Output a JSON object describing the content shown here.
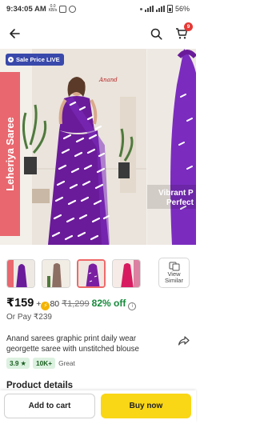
{
  "status_bar": {
    "time": "9:34:05 AM",
    "network_rate": "0.0",
    "network_unit": "KB/s",
    "battery": "56%"
  },
  "header": {
    "back_icon": "arrow-left-icon",
    "search_icon": "search-icon",
    "cart_icon": "cart-icon",
    "cart_count": "9"
  },
  "hero": {
    "sale_badge": "Sale Price LIVE",
    "side_banner": "Leheriya Saree",
    "brand": "Anand",
    "next_caption_line1": "Vibrant P",
    "next_caption_line2": "Perfect"
  },
  "gallery": {
    "thumbnail_count": 4,
    "selected_index": 2,
    "view_similar_line1": "View",
    "view_similar_line2": "Similar"
  },
  "price": {
    "current": "₹159",
    "coins": "80",
    "mrp": "₹1,299",
    "discount": "82% off",
    "or_pay": "Or Pay ₹239"
  },
  "product": {
    "title": "Anand sarees graphic print daily wear georgette saree with unstitched blouse",
    "rating": "3.9",
    "rating_count": "10K+",
    "rating_label": "Great"
  },
  "section": {
    "title": "Product details"
  },
  "actions": {
    "add_to_cart": "Add to cart",
    "buy_now": "Buy now"
  },
  "colors": {
    "discount_green": "#158a3a",
    "buy_yellow": "#f9d616",
    "sale_badge_blue": "#3949ab",
    "saree_purple": "#6a1b9a"
  }
}
